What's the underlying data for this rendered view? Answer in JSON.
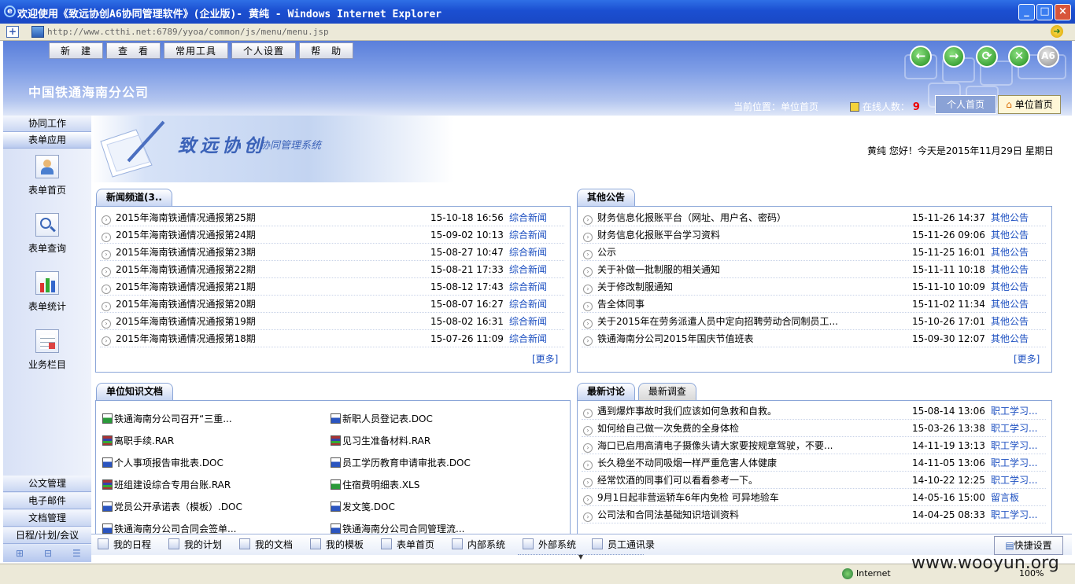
{
  "window": {
    "title": "欢迎使用《致远协创A6协同管理软件》(企业版)- 黄纯 - Windows Internet Explorer",
    "url": "http://www.ctthi.net:6789/yyoa/common/js/menu/menu.jsp"
  },
  "topmenu": [
    "新　建",
    "查　看",
    "常用工具",
    "个人设置",
    "帮　助"
  ],
  "nav_icons": [
    "back-icon",
    "forward-icon",
    "refresh-icon",
    "close-circle-icon",
    "a6-logo-icon"
  ],
  "header": {
    "company": "中国铁通海南分公司",
    "location": "当前位置：单位首页",
    "online_label": "在线人数：",
    "online_count": "9",
    "personal_home": "个人首页",
    "unit_home": "单位首页"
  },
  "sidebar": {
    "top_sections": [
      "协同工作",
      "表单应用"
    ],
    "items": [
      "表单首页",
      "表单查询",
      "表单统计",
      "业务栏目"
    ],
    "bottom_sections": [
      "公文管理",
      "电子邮件",
      "文档管理",
      "日程/计划/会议"
    ]
  },
  "banner": {
    "title": "致远协创",
    "subtitle": "协同管理系统",
    "greeting": "黄纯  您好！今天是2015年11月29日  星期日"
  },
  "news": {
    "tab": "新闻频道(3..",
    "more": "[更多]",
    "rows": [
      {
        "title": "2015年海南铁通情况通报第25期",
        "date": "15-10-18 16:56",
        "cat": "综合新闻"
      },
      {
        "title": "2015年海南铁通情况通报第24期",
        "date": "15-09-02 10:13",
        "cat": "综合新闻"
      },
      {
        "title": "2015年海南铁通情况通报第23期",
        "date": "15-08-27 10:47",
        "cat": "综合新闻"
      },
      {
        "title": "2015年海南铁通情况通报第22期",
        "date": "15-08-21 17:33",
        "cat": "综合新闻"
      },
      {
        "title": "2015年海南铁通情况通报第21期",
        "date": "15-08-12 17:43",
        "cat": "综合新闻"
      },
      {
        "title": "2015年海南铁通情况通报第20期",
        "date": "15-08-07 16:27",
        "cat": "综合新闻"
      },
      {
        "title": "2015年海南铁通情况通报第19期",
        "date": "15-08-02 16:31",
        "cat": "综合新闻"
      },
      {
        "title": "2015年海南铁通情况通报第18期",
        "date": "15-07-26 11:09",
        "cat": "综合新闻"
      }
    ]
  },
  "notices": {
    "tab": "其他公告",
    "more": "[更多]",
    "rows": [
      {
        "title": "财务信息化报账平台（网址、用户名、密码）",
        "date": "15-11-26 14:37",
        "cat": "其他公告"
      },
      {
        "title": "财务信息化报账平台学习资料",
        "date": "15-11-26 09:06",
        "cat": "其他公告"
      },
      {
        "title": "公示",
        "date": "15-11-25 16:01",
        "cat": "其他公告"
      },
      {
        "title": "关于补做一批制服的相关通知",
        "date": "15-11-11 10:18",
        "cat": "其他公告"
      },
      {
        "title": "关于修改制服通知",
        "date": "15-11-10 10:09",
        "cat": "其他公告"
      },
      {
        "title": "告全体同事",
        "date": "15-11-02 11:34",
        "cat": "其他公告"
      },
      {
        "title": "关于2015年在劳务派遣人员中定向招聘劳动合同制员工...",
        "date": "15-10-26 17:01",
        "cat": "其他公告"
      },
      {
        "title": "铁通海南分公司2015年国庆节值班表",
        "date": "15-09-30 12:07",
        "cat": "其他公告"
      }
    ]
  },
  "knowledge": {
    "tab": "单位知识文档",
    "docs": [
      {
        "name": "铁通海南分公司召开“三重...",
        "type": "x"
      },
      {
        "name": "新职人员登记表.DOC",
        "type": "w"
      },
      {
        "name": "离职手续.RAR",
        "type": "r"
      },
      {
        "name": "见习生准备材料.RAR",
        "type": "r"
      },
      {
        "name": "个人事项报告审批表.DOC",
        "type": "w"
      },
      {
        "name": "员工学历教育申请审批表.DOC",
        "type": "w"
      },
      {
        "name": "班组建设综合专用台账.RAR",
        "type": "r"
      },
      {
        "name": "住宿费明细表.XLS",
        "type": "x"
      },
      {
        "name": "党员公开承诺表（模板）.DOC",
        "type": "w"
      },
      {
        "name": "发文笺.DOC",
        "type": "w"
      },
      {
        "name": "铁通海南分公司合同会签单...",
        "type": "w"
      },
      {
        "name": "铁通海南分公司合同管理流...",
        "type": "w"
      }
    ]
  },
  "discussion": {
    "tab_active": "最新讨论",
    "tab_inactive": "最新调查",
    "rows": [
      {
        "title": "遇到爆炸事故时我们应该如何急救和自救。",
        "date": "15-08-14 13:06",
        "cat": "职工学习..."
      },
      {
        "title": "如何给自己做一次免费的全身体检",
        "date": "15-03-26 13:38",
        "cat": "职工学习..."
      },
      {
        "title": "海口已启用高清电子摄像头请大家要按规章驾驶，不要...",
        "date": "14-11-19 13:13",
        "cat": "职工学习..."
      },
      {
        "title": "长久稳坐不动同吸烟一样严重危害人体健康",
        "date": "14-11-05 13:06",
        "cat": "职工学习..."
      },
      {
        "title": "经常饮酒的同事们可以看看参考一下。",
        "date": "14-10-22 12:25",
        "cat": "职工学习..."
      },
      {
        "title": "9月1日起非营运轿车6年内免检 可异地验车",
        "date": "14-05-16 15:00",
        "cat": "留言板"
      },
      {
        "title": "公司法和合同法基础知识培训资料",
        "date": "14-04-25 08:33",
        "cat": "职工学习..."
      }
    ]
  },
  "bottombar": [
    "我的日程",
    "我的计划",
    "我的文档",
    "我的模板",
    "表单首页",
    "内部系统",
    "外部系统",
    "员工通讯录"
  ],
  "shortcut": "快捷设置",
  "status": {
    "zone": "Internet",
    "zoom": "100%"
  },
  "watermark": "www.wooyun.org"
}
